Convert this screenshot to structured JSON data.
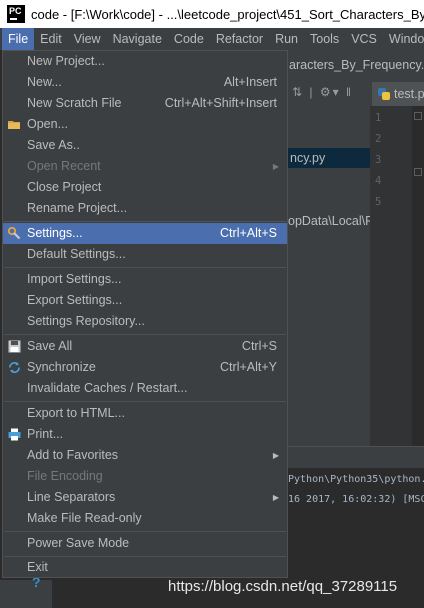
{
  "window": {
    "app_logo": "PC",
    "title": "code - [F:\\Work\\code] - ...\\leetcode_project\\451_Sort_Characters_By"
  },
  "menubar": [
    {
      "label": "File",
      "active": true
    },
    {
      "label": "Edit"
    },
    {
      "label": "View"
    },
    {
      "label": "Navigate"
    },
    {
      "label": "Code"
    },
    {
      "label": "Refactor"
    },
    {
      "label": "Run"
    },
    {
      "label": "Tools"
    },
    {
      "label": "VCS"
    },
    {
      "label": "Windo"
    }
  ],
  "background": {
    "breadcrumb": "aracters_By_Frequency.py",
    "editor_tab": "test.p",
    "project_selected": "ncy.py",
    "project_path": "opData\\Local\\F",
    "line_numbers": [
      "1",
      "2",
      "3",
      "4",
      "5"
    ],
    "console_lines": [
      "Python\\Python35\\python.",
      "16 2017, 16:02:32) [MSC"
    ]
  },
  "file_menu": {
    "items": [
      {
        "label": "New Project...",
        "shortcut": ""
      },
      {
        "label": "New...",
        "shortcut": "Alt+Insert"
      },
      {
        "label": "New Scratch File",
        "shortcut": "Ctrl+Alt+Shift+Insert"
      },
      {
        "label": "Open...",
        "shortcut": "",
        "icon": "folder-icon"
      },
      {
        "label": "Save As..",
        "shortcut": ""
      },
      {
        "label": "Open Recent",
        "shortcut": "",
        "submenu": true,
        "disabled": true
      },
      {
        "label": "Close Project",
        "shortcut": ""
      },
      {
        "label": "Rename Project...",
        "shortcut": ""
      },
      {
        "label": "Settings...",
        "shortcut": "Ctrl+Alt+S",
        "icon": "wrench-icon",
        "highlighted": true
      },
      {
        "label": "Default Settings...",
        "shortcut": ""
      },
      {
        "label": "Import Settings...",
        "shortcut": ""
      },
      {
        "label": "Export Settings...",
        "shortcut": ""
      },
      {
        "label": "Settings Repository...",
        "shortcut": ""
      },
      {
        "label": "Save All",
        "shortcut": "Ctrl+S",
        "icon": "save-icon"
      },
      {
        "label": "Synchronize",
        "shortcut": "Ctrl+Alt+Y",
        "icon": "sync-icon"
      },
      {
        "label": "Invalidate Caches / Restart...",
        "shortcut": ""
      },
      {
        "label": "Export to HTML...",
        "shortcut": ""
      },
      {
        "label": "Print...",
        "shortcut": "",
        "icon": "print-icon"
      },
      {
        "label": "Add to Favorites",
        "shortcut": "",
        "submenu": true
      },
      {
        "label": "File Encoding",
        "shortcut": "",
        "disabled": true
      },
      {
        "label": "Line Separators",
        "shortcut": "",
        "submenu": true
      },
      {
        "label": "Make File Read-only",
        "shortcut": ""
      },
      {
        "label": "Power Save Mode",
        "shortcut": ""
      },
      {
        "label": "Exit",
        "shortcut": ""
      }
    ]
  },
  "watermark": "https://blog.csdn.net/qq_37289115",
  "colors": {
    "menu_bg": "#3c3f41",
    "highlight": "#4b6eaf",
    "text": "#bbbbbb",
    "disabled_text": "#777777"
  }
}
